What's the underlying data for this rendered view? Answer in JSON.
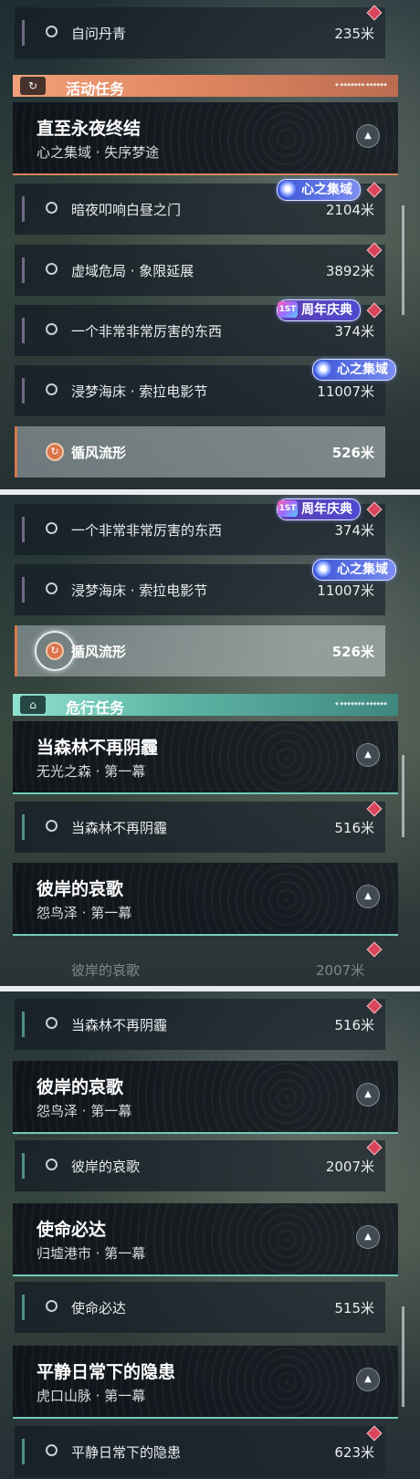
{
  "badges": {
    "heart_domain": "心之集域",
    "anniversary": "周年庆典",
    "anniv_logo": "1ST"
  },
  "icons": {
    "waypoint": "diamond-waypoint-icon",
    "objective": "circle-objective-icon",
    "collapse": "chevron-up-icon"
  },
  "colors": {
    "activity_accent": "#e38a63",
    "peril_accent": "#5fb7a6",
    "waypoint": "#d9455a"
  },
  "panel1": {
    "prev_sub": {
      "name": "自问丹青",
      "distance": "235米"
    },
    "activity_section": {
      "title": "活动任务"
    },
    "main_quest": {
      "title": "直至永夜终结",
      "subtitle": "心之集域 · 失序梦途"
    },
    "subs": [
      {
        "name": "暗夜叩响白昼之门",
        "distance": "2104米"
      },
      {
        "name": "虚域危局 · 象限延展",
        "distance": "3892米"
      },
      {
        "name": "一个非常非常厉害的东西",
        "distance": "374米"
      },
      {
        "name": "浸梦海床 · 索拉电影节",
        "distance": "11007米"
      },
      {
        "name": "循风流形",
        "distance": "526米"
      }
    ]
  },
  "panel2": {
    "subs": [
      {
        "name": "一个非常非常厉害的东西",
        "distance": "374米"
      },
      {
        "name": "浸梦海床 · 索拉电影节",
        "distance": "11007米"
      },
      {
        "name": "循风流形",
        "distance": "526米"
      }
    ],
    "peril_section": {
      "title": "危行任务"
    },
    "quests": [
      {
        "title": "当森林不再阴霾",
        "subtitle": "无光之森 · 第一幕",
        "sub_name": "当森林不再阴霾",
        "sub_distance": "516米"
      },
      {
        "title": "彼岸的哀歌",
        "subtitle": "怨鸟泽 · 第一幕",
        "sub_name": "彼岸的哀歌",
        "sub_distance": "2007米"
      }
    ]
  },
  "panel3": {
    "quests": [
      {
        "title": "当森林不再阴霾",
        "sub_name": "当森林不再阴霾",
        "sub_distance": "516米"
      },
      {
        "title": "彼岸的哀歌",
        "subtitle": "怨鸟泽 · 第一幕",
        "sub_name": "彼岸的哀歌",
        "sub_distance": "2007米"
      },
      {
        "title": "使命必达",
        "subtitle": "归墟港市 · 第一幕",
        "sub_name": "使命必达",
        "sub_distance": "515米"
      },
      {
        "title": "平静日常下的隐患",
        "subtitle": "虎口山脉 · 第一幕",
        "sub_name": "平静日常下的隐患",
        "sub_distance": "623米"
      }
    ]
  }
}
